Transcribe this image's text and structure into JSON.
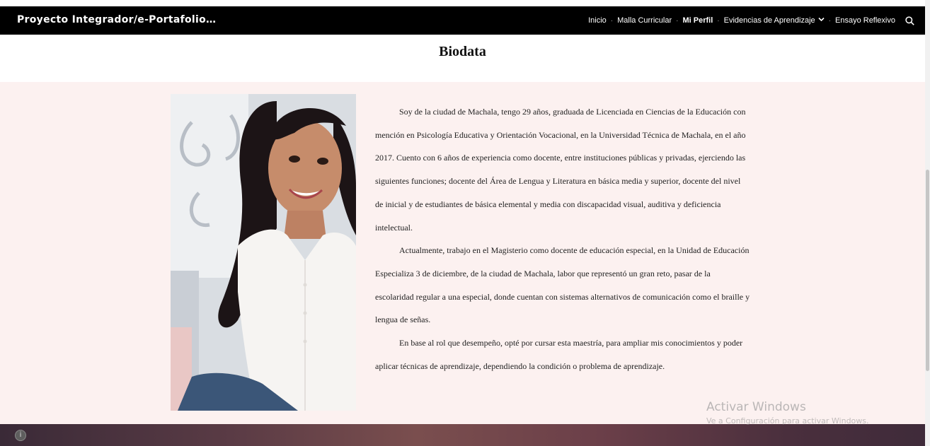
{
  "nav": {
    "site_title": "Proyecto Integrador/e-Portafolio…",
    "items": [
      {
        "label": "Inicio"
      },
      {
        "label": "Malla Curricular"
      },
      {
        "label": "Mi Perfil"
      },
      {
        "label": "Evidencias de Aprendizaje"
      },
      {
        "label": "Ensayo Reflexivo"
      }
    ],
    "separator": "·",
    "active_item": "Mi Perfil",
    "icons": {
      "dropdown": "chevron-down-icon",
      "search": "search-icon"
    }
  },
  "main": {
    "heading": "Biodata",
    "photo_icon": "profile-photo",
    "paragraphs": [
      "Soy de la ciudad de Machala, tengo 29 años, graduada de Licenciada en Ciencias de la Educación con mención en Psicología Educativa y Orientación Vocacional, en la Universidad Técnica de Machala, en el año 2017. Cuento con 6 años de experiencia como docente, entre instituciones públicas y privadas, ejerciendo las siguientes funciones; docente del Área de Lengua y Literatura en básica media y superior, docente del nivel de inicial y de estudiantes de básica elemental y media con discapacidad visual, auditiva y deficiencia intelectual.",
      "Actualmente, trabajo en el Magisterio como docente de educación especial, en la Unidad de Educación Especializa 3 de diciembre, de la ciudad de Machala, labor que representó un gran reto, pasar de la escolaridad regular a una especial, donde cuentan con sistemas alternativos de comunicación como el braille y lengua de señas.",
      "En base al rol que desempeño, opté por cursar esta maestría, para ampliar mis conocimientos y poder aplicar técnicas de aprendizaje, dependiendo la condición o problema de aprendizaje."
    ]
  },
  "watermark": {
    "title": "Activar Windows",
    "subtitle": "Ve a Configuración para activar Windows."
  },
  "footer": {
    "info_icon": "info-icon"
  },
  "colors": {
    "nav_bg": "#000000",
    "section_bg": "#fcf1f0",
    "footer_accent": "#6b3f49"
  }
}
